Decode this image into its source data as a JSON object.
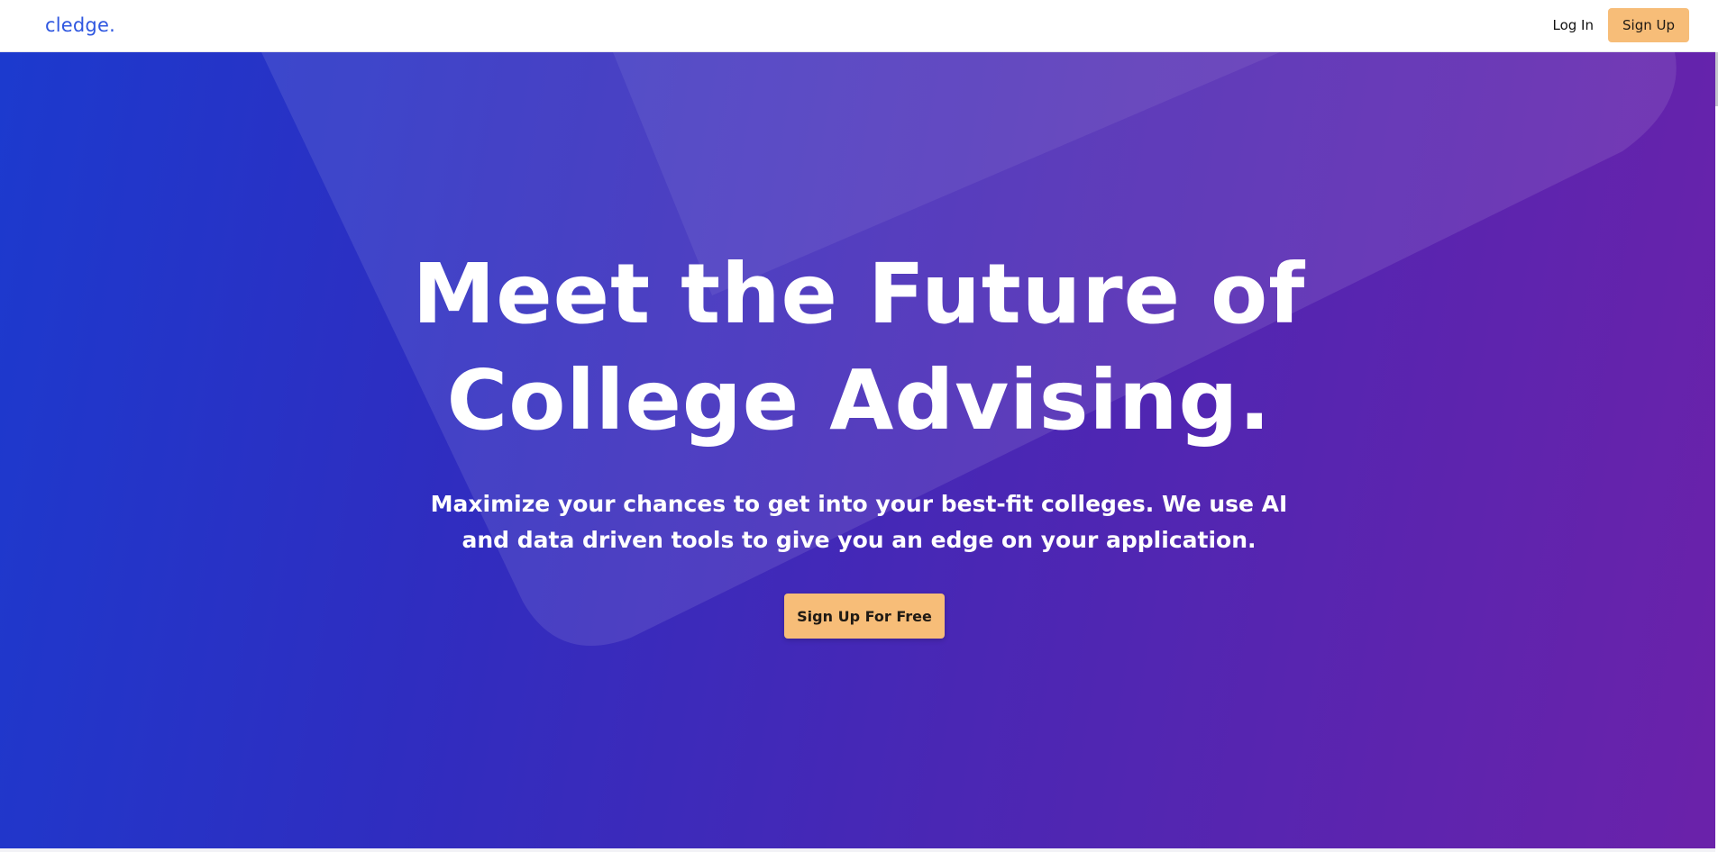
{
  "header": {
    "logo": "cledge.",
    "login_label": "Log In",
    "signup_label": "Sign Up"
  },
  "hero": {
    "title_line1": "Meet the Future of",
    "title_line2": "College Advising.",
    "subtitle_line1": "Maximize your chances to get into your best-fit colleges. We use AI",
    "subtitle_line2": "and data driven tools to give you an edge on your application.",
    "cta_label": "Sign Up For Free"
  },
  "colors": {
    "brand_blue": "#2f57e0",
    "accent_orange": "#f7bd78",
    "hero_gradient_start": "#1c3ace",
    "hero_gradient_end": "#6b22aa"
  }
}
